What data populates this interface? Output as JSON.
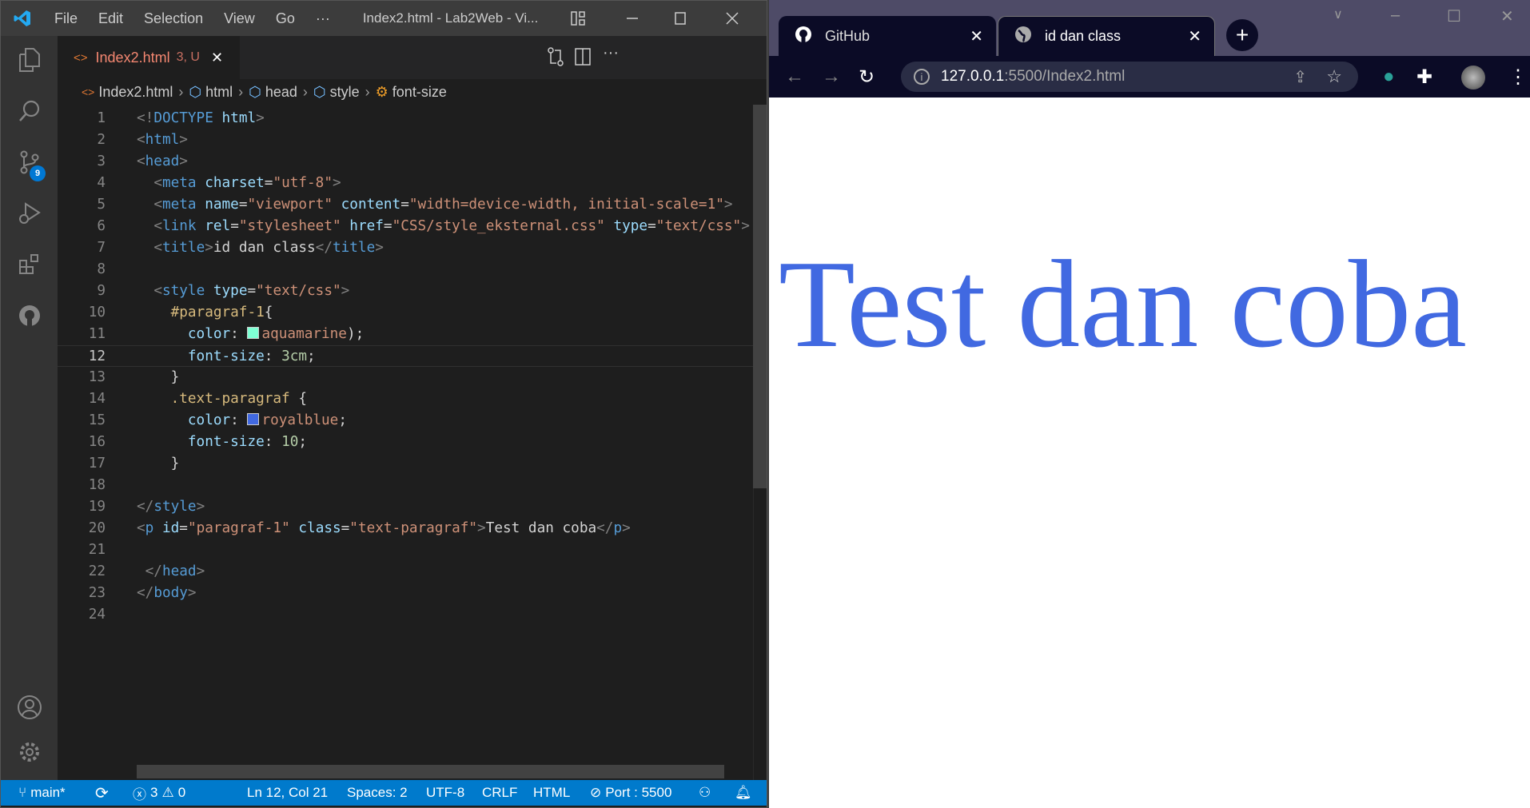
{
  "vscode": {
    "menu": [
      "File",
      "Edit",
      "Selection",
      "View",
      "Go",
      "···"
    ],
    "window_title": "Index2.html - Lab2Web - Vi...",
    "activity_badge": "9",
    "tab": {
      "label": "Index2.html",
      "status": "3, U",
      "close": "✕"
    },
    "breadcrumb": [
      "Index2.html",
      "html",
      "head",
      "style",
      "font-size"
    ],
    "lines": [
      [
        [
          "t-p",
          "<!"
        ],
        [
          "t-kw",
          "DOCTYPE"
        ],
        [
          "t-txt",
          " "
        ],
        [
          "t-attr",
          "html"
        ],
        [
          "t-p",
          ">"
        ]
      ],
      [
        [
          "t-p",
          "<"
        ],
        [
          "t-tag",
          "html"
        ],
        [
          "t-p",
          ">"
        ]
      ],
      [
        [
          "t-p",
          "<"
        ],
        [
          "t-tag",
          "head"
        ],
        [
          "t-p",
          ">"
        ]
      ],
      [
        [
          "t-txt",
          "  "
        ],
        [
          "t-p",
          "<"
        ],
        [
          "t-tag",
          "meta"
        ],
        [
          "t-txt",
          " "
        ],
        [
          "t-attr",
          "charset"
        ],
        [
          "t-txt",
          "="
        ],
        [
          "t-str",
          "\"utf-8\""
        ],
        [
          "t-p",
          ">"
        ]
      ],
      [
        [
          "t-txt",
          "  "
        ],
        [
          "t-p",
          "<"
        ],
        [
          "t-tag",
          "meta"
        ],
        [
          "t-txt",
          " "
        ],
        [
          "t-attr",
          "name"
        ],
        [
          "t-txt",
          "="
        ],
        [
          "t-str",
          "\"viewport\""
        ],
        [
          "t-txt",
          " "
        ],
        [
          "t-attr",
          "content"
        ],
        [
          "t-txt",
          "="
        ],
        [
          "t-str",
          "\"width=device-width, initial-scale=1\""
        ],
        [
          "t-p",
          ">"
        ]
      ],
      [
        [
          "t-txt",
          "  "
        ],
        [
          "t-p",
          "<"
        ],
        [
          "t-tag",
          "link"
        ],
        [
          "t-txt",
          " "
        ],
        [
          "t-attr",
          "rel"
        ],
        [
          "t-txt",
          "="
        ],
        [
          "t-str",
          "\"stylesheet\""
        ],
        [
          "t-txt",
          " "
        ],
        [
          "t-attr",
          "href"
        ],
        [
          "t-txt",
          "="
        ],
        [
          "t-str",
          "\"CSS/style_eksternal.css\""
        ],
        [
          "t-txt",
          " "
        ],
        [
          "t-attr",
          "type"
        ],
        [
          "t-txt",
          "="
        ],
        [
          "t-str",
          "\"text/css\""
        ],
        [
          "t-p",
          ">"
        ]
      ],
      [
        [
          "t-txt",
          "  "
        ],
        [
          "t-p",
          "<"
        ],
        [
          "t-tag",
          "title"
        ],
        [
          "t-p",
          ">"
        ],
        [
          "t-txt",
          "id dan class"
        ],
        [
          "t-p",
          "</"
        ],
        [
          "t-tag",
          "title"
        ],
        [
          "t-p",
          ">"
        ]
      ],
      [],
      [
        [
          "t-txt",
          "  "
        ],
        [
          "t-p",
          "<"
        ],
        [
          "t-tag",
          "style"
        ],
        [
          "t-txt",
          " "
        ],
        [
          "t-attr",
          "type"
        ],
        [
          "t-txt",
          "="
        ],
        [
          "t-str",
          "\"text/css\""
        ],
        [
          "t-p",
          ">"
        ]
      ],
      [
        [
          "t-txt",
          "    "
        ],
        [
          "t-sel",
          "#paragraf-1"
        ],
        [
          "t-txt",
          "{"
        ]
      ],
      [
        [
          "t-txt",
          "      "
        ],
        [
          "t-attr",
          "color"
        ],
        [
          "t-txt",
          ": "
        ],
        [
          "sw",
          "#7fffd4"
        ],
        [
          "t-str",
          "aquamarine"
        ],
        [
          "t-txt",
          ");"
        ]
      ],
      [
        [
          "t-txt",
          "      "
        ],
        [
          "t-attr",
          "font-size"
        ],
        [
          "t-txt",
          ": "
        ],
        [
          "t-num",
          "3cm"
        ],
        [
          "t-txt",
          ";"
        ]
      ],
      [
        [
          "t-txt",
          "    }"
        ]
      ],
      [
        [
          "t-txt",
          "    "
        ],
        [
          "t-sel",
          ".text-paragraf"
        ],
        [
          "t-txt",
          " {"
        ]
      ],
      [
        [
          "t-txt",
          "      "
        ],
        [
          "t-attr",
          "color"
        ],
        [
          "t-txt",
          ": "
        ],
        [
          "sw",
          "#4169e1"
        ],
        [
          "t-str",
          "royalblue"
        ],
        [
          "t-txt",
          ";"
        ]
      ],
      [
        [
          "t-txt",
          "      "
        ],
        [
          "t-attr",
          "font-size"
        ],
        [
          "t-txt",
          ": "
        ],
        [
          "t-num",
          "10"
        ],
        [
          "t-txt",
          ";"
        ]
      ],
      [
        [
          "t-txt",
          "    }"
        ]
      ],
      [],
      [
        [
          "t-p",
          "</"
        ],
        [
          "t-tag",
          "style"
        ],
        [
          "t-p",
          ">"
        ]
      ],
      [
        [
          "t-p",
          "<"
        ],
        [
          "t-tag",
          "p"
        ],
        [
          "t-txt",
          " "
        ],
        [
          "t-attr",
          "id"
        ],
        [
          "t-txt",
          "="
        ],
        [
          "t-str",
          "\"paragraf-1\""
        ],
        [
          "t-txt",
          " "
        ],
        [
          "t-attr",
          "class"
        ],
        [
          "t-txt",
          "="
        ],
        [
          "t-str",
          "\"text-paragraf\""
        ],
        [
          "t-p",
          ">"
        ],
        [
          "t-txt",
          "Test dan coba"
        ],
        [
          "t-p",
          "</"
        ],
        [
          "t-tag",
          "p"
        ],
        [
          "t-p",
          ">"
        ]
      ],
      [],
      [
        [
          "t-txt",
          " "
        ],
        [
          "t-p",
          "</"
        ],
        [
          "t-tag",
          "head"
        ],
        [
          "t-p",
          ">"
        ]
      ],
      [
        [
          "t-p",
          "</"
        ],
        [
          "t-tag",
          "body"
        ],
        [
          "t-p",
          ">"
        ]
      ],
      []
    ],
    "current_line": 12,
    "status": {
      "branch": "main*",
      "errors": "3",
      "warnings": "0",
      "position": "Ln 12, Col 21",
      "spaces": "Spaces: 2",
      "encoding": "UTF-8",
      "eol": "CRLF",
      "language": "HTML",
      "port": "Port : 5500"
    }
  },
  "browser": {
    "tabs": [
      {
        "label": "GitHub",
        "close": "✕"
      },
      {
        "label": "id dan class",
        "close": "✕"
      }
    ],
    "new_tab": "+",
    "url_host": "127.0.0.1",
    "url_rest": ":5500/Index2.html",
    "page_text": "Test dan coba"
  },
  "colors": {
    "accent": "#007acc",
    "paragraph": "#4169e1"
  }
}
